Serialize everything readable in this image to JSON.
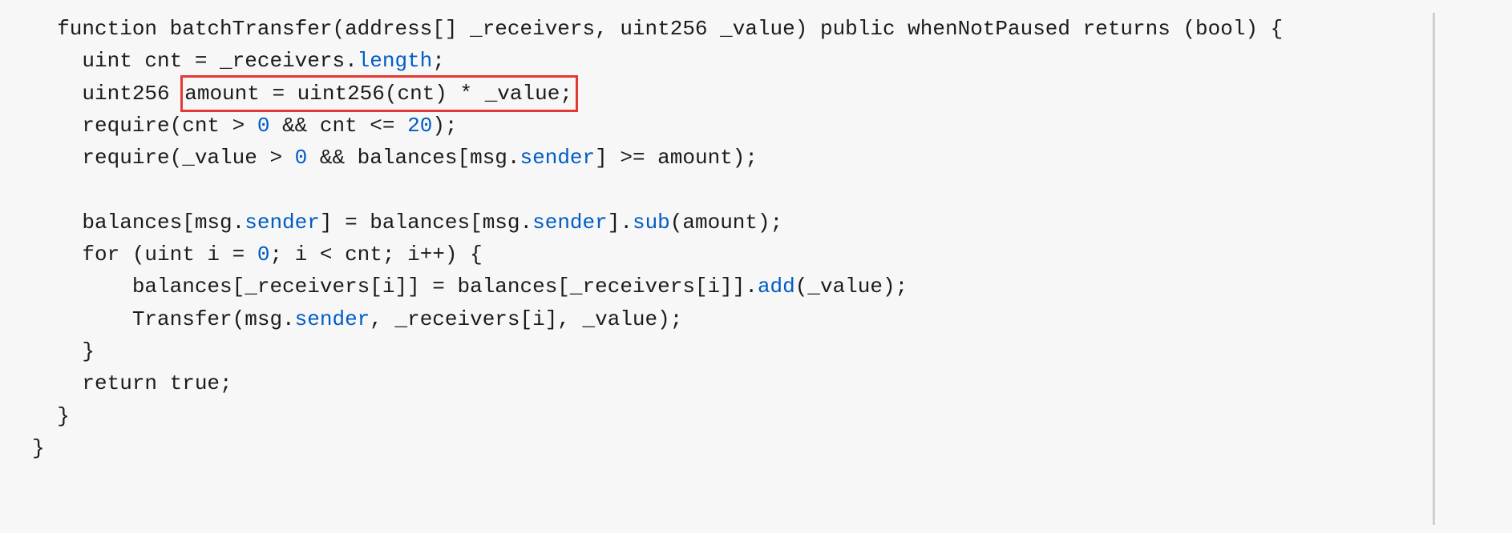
{
  "code": {
    "l1a": "  function batchTransfer(address[] _receivers, uint256 _value) public whenNotPaused returns (bool) {",
    "l2a": "    uint cnt = _receivers.",
    "l2b": "length",
    "l2c": ";",
    "l3a": "    uint256 ",
    "l3h": "amount = uint256(cnt) * _value;",
    "l4a": "    require(cnt > ",
    "l4n1": "0",
    "l4b": " && cnt <= ",
    "l4n2": "20",
    "l4c": ");",
    "l5a": "    require(_value > ",
    "l5n1": "0",
    "l5b": " && balances[msg.",
    "l5p1": "sender",
    "l5c": "] >= amount);",
    "l6": "",
    "l7a": "    balances[msg.",
    "l7p1": "sender",
    "l7b": "] = balances[msg.",
    "l7p2": "sender",
    "l7c": "].",
    "l7p3": "sub",
    "l7d": "(amount);",
    "l8a": "    for (uint i = ",
    "l8n1": "0",
    "l8b": "; i < cnt; i++) {",
    "l9a": "        balances[_receivers[i]] = balances[_receivers[i]].",
    "l9p1": "add",
    "l9b": "(_value);",
    "l10a": "        Transfer(msg.",
    "l10p1": "sender",
    "l10b": ", _receivers[i], _value);",
    "l11": "    }",
    "l12": "    return true;",
    "l13": "  }",
    "l14": "}"
  }
}
